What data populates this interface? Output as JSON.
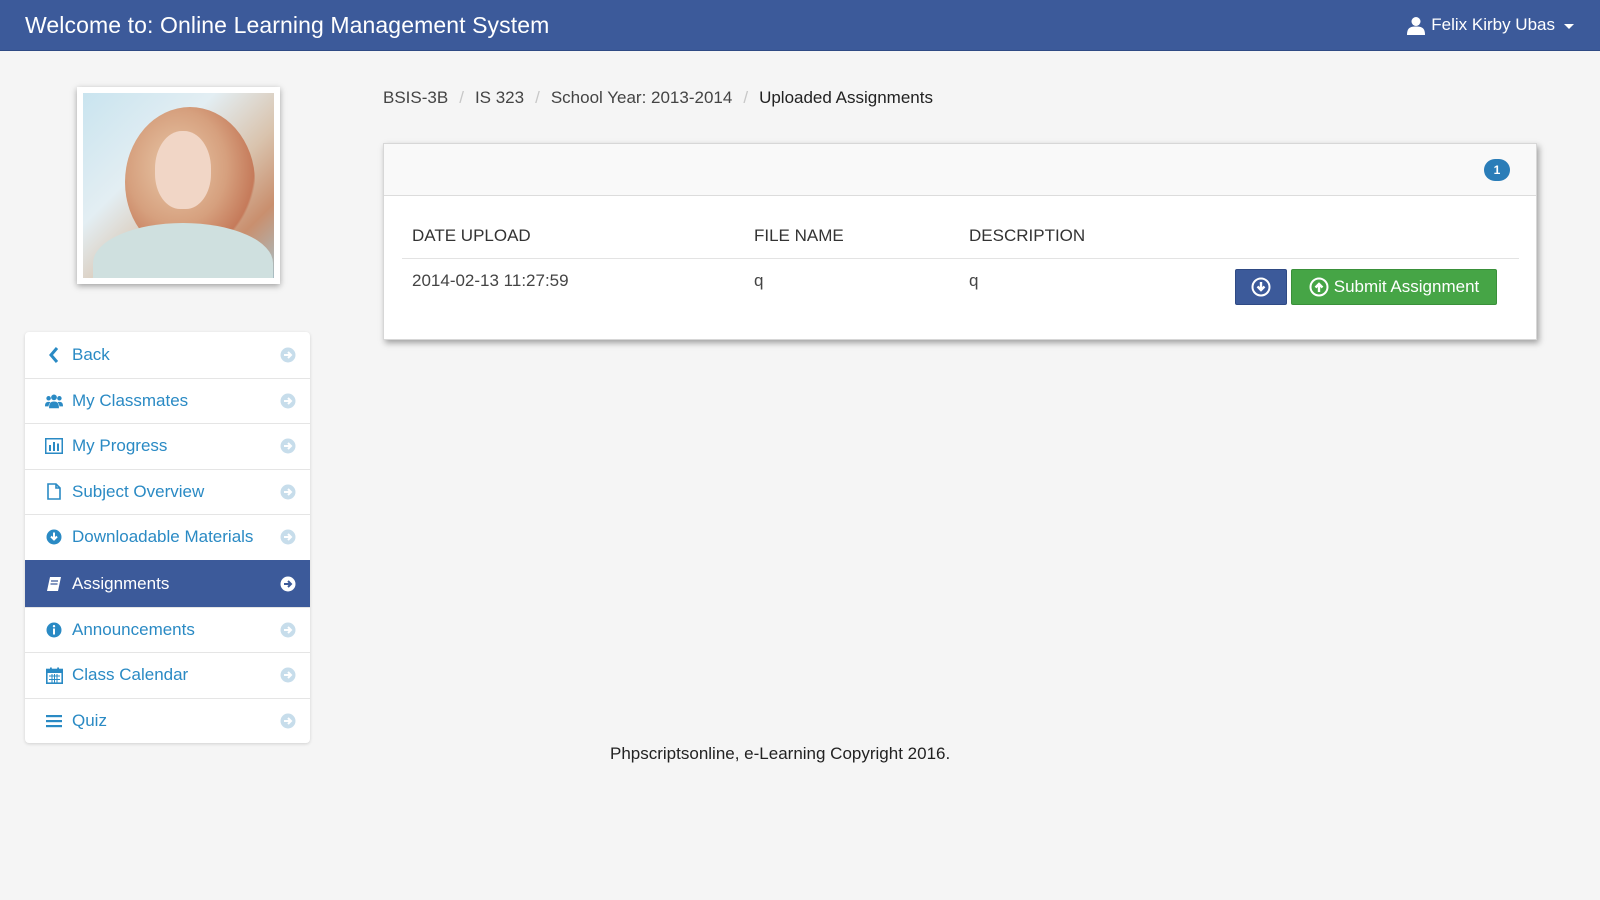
{
  "navbar": {
    "brand": "Welcome to: Online Learning Management System",
    "user_name": "Felix Kirby Ubas",
    "bg_color": "#3c5a9a"
  },
  "sidebar": {
    "items": [
      {
        "label": "Back",
        "icon": "chevron-left-icon",
        "active": false
      },
      {
        "label": "My Classmates",
        "icon": "users-icon",
        "active": false
      },
      {
        "label": "My Progress",
        "icon": "bar-chart-icon",
        "active": false
      },
      {
        "label": "Subject Overview",
        "icon": "file-icon",
        "active": false
      },
      {
        "label": "Downloadable Materials",
        "icon": "download-circle-icon",
        "active": false
      },
      {
        "label": "Assignments",
        "icon": "book-icon",
        "active": true
      },
      {
        "label": "Announcements",
        "icon": "info-icon",
        "active": false
      },
      {
        "label": "Class Calendar",
        "icon": "calendar-icon",
        "active": false
      },
      {
        "label": "Quiz",
        "icon": "list-icon",
        "active": false
      }
    ]
  },
  "breadcrumb": {
    "items": [
      "BSIS-3B",
      "IS 323",
      "School Year: 2013-2014"
    ],
    "current": "Uploaded Assignments",
    "separator": "/"
  },
  "panel": {
    "badge_count": "1",
    "table": {
      "headers": [
        "DATE UPLOAD",
        "FILE NAME",
        "DESCRIPTION"
      ],
      "rows": [
        {
          "date_upload": "2014-02-13 11:27:59",
          "file_name": "q",
          "description": "q"
        }
      ]
    },
    "submit_label": "Submit Assignment"
  },
  "footer": {
    "text": "Phpscriptsonline, e-Learning Copyright 2016."
  },
  "colors": {
    "primary": "#3c5a9a",
    "link": "#2a8ac4",
    "success": "#46a546",
    "badge": "#2a7db8"
  }
}
